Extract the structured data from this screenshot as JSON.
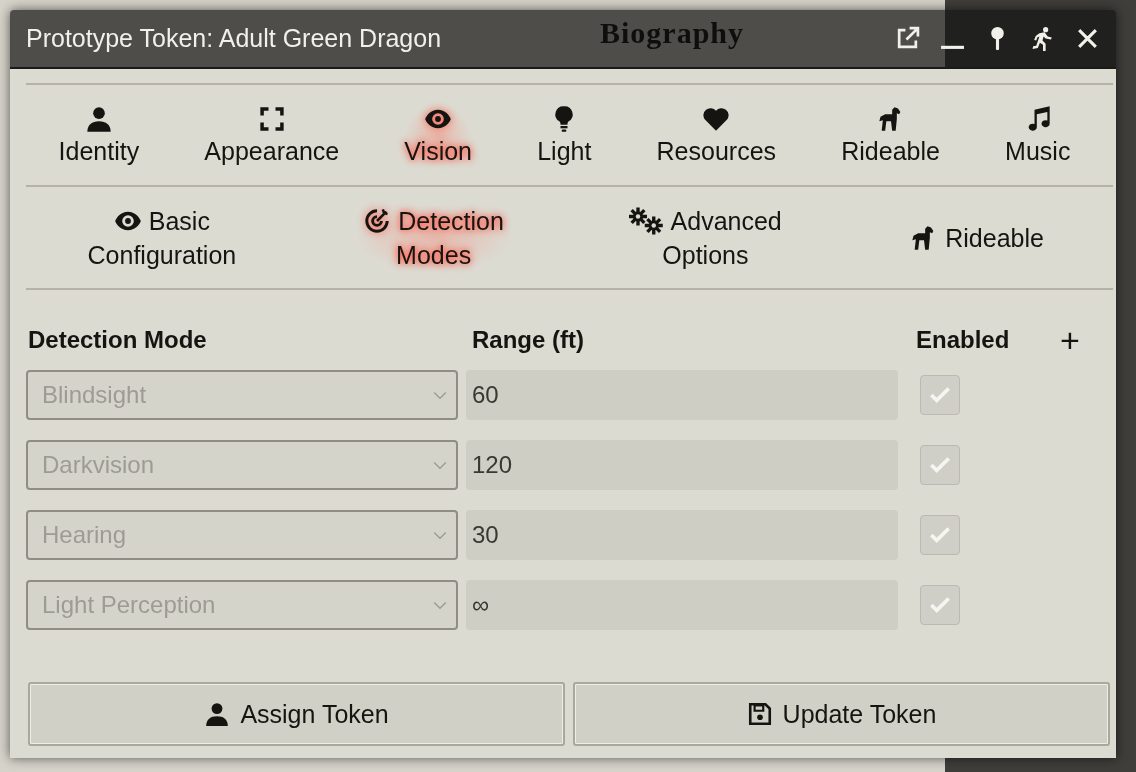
{
  "background_sheet": {
    "tabs": [
      "Biography"
    ]
  },
  "window": {
    "title": "Prototype Token: Adult Green Dragon"
  },
  "tabs": [
    {
      "label": "Identity",
      "selected": false
    },
    {
      "label": "Appearance",
      "selected": false
    },
    {
      "label": "Vision",
      "selected": true
    },
    {
      "label": "Light",
      "selected": false
    },
    {
      "label": "Resources",
      "selected": false
    },
    {
      "label": "Rideable",
      "selected": false
    },
    {
      "label": "Music",
      "selected": false
    }
  ],
  "subtabs": [
    {
      "label": "Basic Configuration",
      "selected": false
    },
    {
      "label": "Detection Modes",
      "selected": true
    },
    {
      "label": "Advanced Options",
      "selected": false
    },
    {
      "label": "Rideable",
      "selected": false
    }
  ],
  "table": {
    "columns": [
      "Detection Mode",
      "Range (ft)",
      "Enabled"
    ],
    "add_button": "+",
    "rows": [
      {
        "mode": "Blindsight",
        "range": "60",
        "enabled": true,
        "disabled": true
      },
      {
        "mode": "Darkvision",
        "range": "120",
        "enabled": true,
        "disabled": true
      },
      {
        "mode": "Hearing",
        "range": "30",
        "enabled": true,
        "disabled": true
      },
      {
        "mode": "Light Perception",
        "range": "∞",
        "enabled": true,
        "disabled": true
      }
    ]
  },
  "buttons": [
    {
      "label": "Assign Token"
    },
    {
      "label": "Update Token"
    }
  ]
}
